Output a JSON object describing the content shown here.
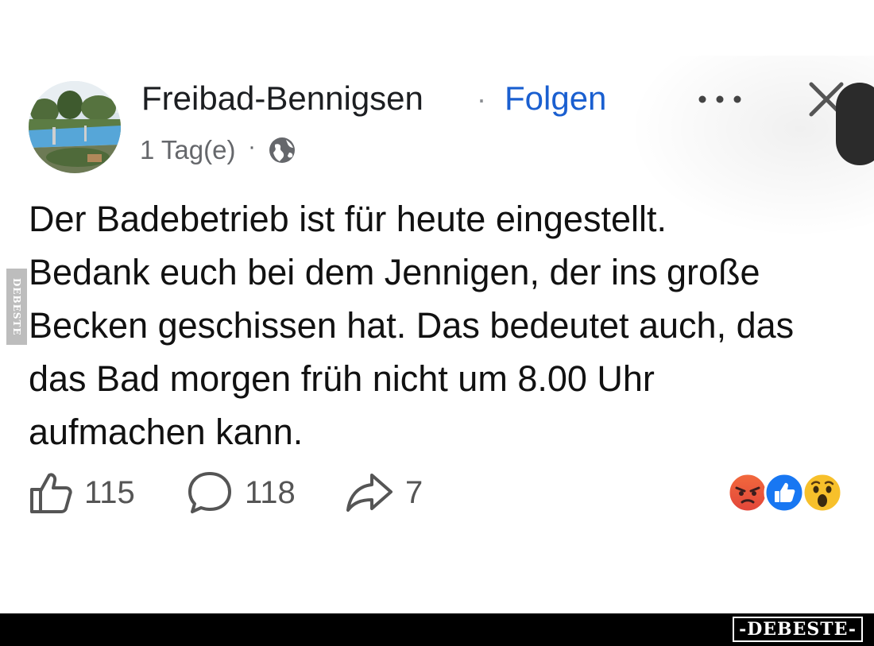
{
  "post": {
    "page_name": "Freibad-Bennigsen",
    "separator": "·",
    "follow_label": "Folgen",
    "time": "1 Tag(e)",
    "meta_separator": "·",
    "privacy_icon": "globe-icon",
    "text_lines": [
      "Der Badebetrieb ist für heute eingestellt.",
      "Bedank euch bei dem Jennigen, der ins große",
      "Becken geschissen hat. Das bedeutet auch, das",
      "das Bad morgen früh nicht um 8.00 Uhr",
      "aufmachen kann."
    ],
    "actions": {
      "like_count": "115",
      "comment_count": "118",
      "share_count": "7"
    },
    "reactions": [
      "angry-reaction-icon",
      "like-reaction-icon",
      "wow-reaction-icon"
    ]
  },
  "watermark": {
    "side": "DEBESTE",
    "footer": "-DEBESTE-"
  },
  "colors": {
    "follow": "#1a5fd0",
    "like_reaction": "#1877f2",
    "angry_reaction": "#e8553c",
    "wow_reaction": "#f7c02b"
  }
}
